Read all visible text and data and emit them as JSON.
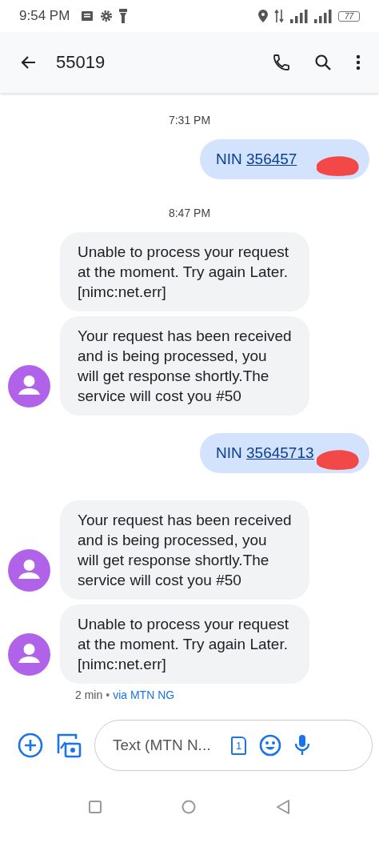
{
  "status_bar": {
    "time": "9:54 PM",
    "battery": "77"
  },
  "app_bar": {
    "title": "55019"
  },
  "messages": [
    {
      "kind": "timestamp",
      "text": "7:31 PM"
    },
    {
      "kind": "outgoing",
      "prefix": "NIN",
      "link": "356457",
      "redacted": true
    },
    {
      "kind": "timestamp",
      "text": "8:47 PM"
    },
    {
      "kind": "incoming",
      "text": "Unable to process your request at the moment. Try again Later. [nimc:net.err]",
      "avatar": false
    },
    {
      "kind": "incoming",
      "text": "Your request has been received and is being processed, you will get response shortly.The service will cost you #50",
      "avatar": true
    },
    {
      "kind": "outgoing",
      "prefix": "NIN",
      "link": "35645713",
      "redacted": true
    },
    {
      "kind": "incoming",
      "text": "Your request has been received and is being processed, you will get response shortly.The service will cost you #50",
      "avatar": true
    },
    {
      "kind": "incoming",
      "text": "Unable to process your request at the moment. Try again Later. [nimc:net.err]",
      "avatar": true
    }
  ],
  "footer": {
    "age": "2 min",
    "separator": "•",
    "via": "via MTN NG"
  },
  "composer": {
    "placeholder": "Text (MTN N...",
    "sim": "1"
  }
}
